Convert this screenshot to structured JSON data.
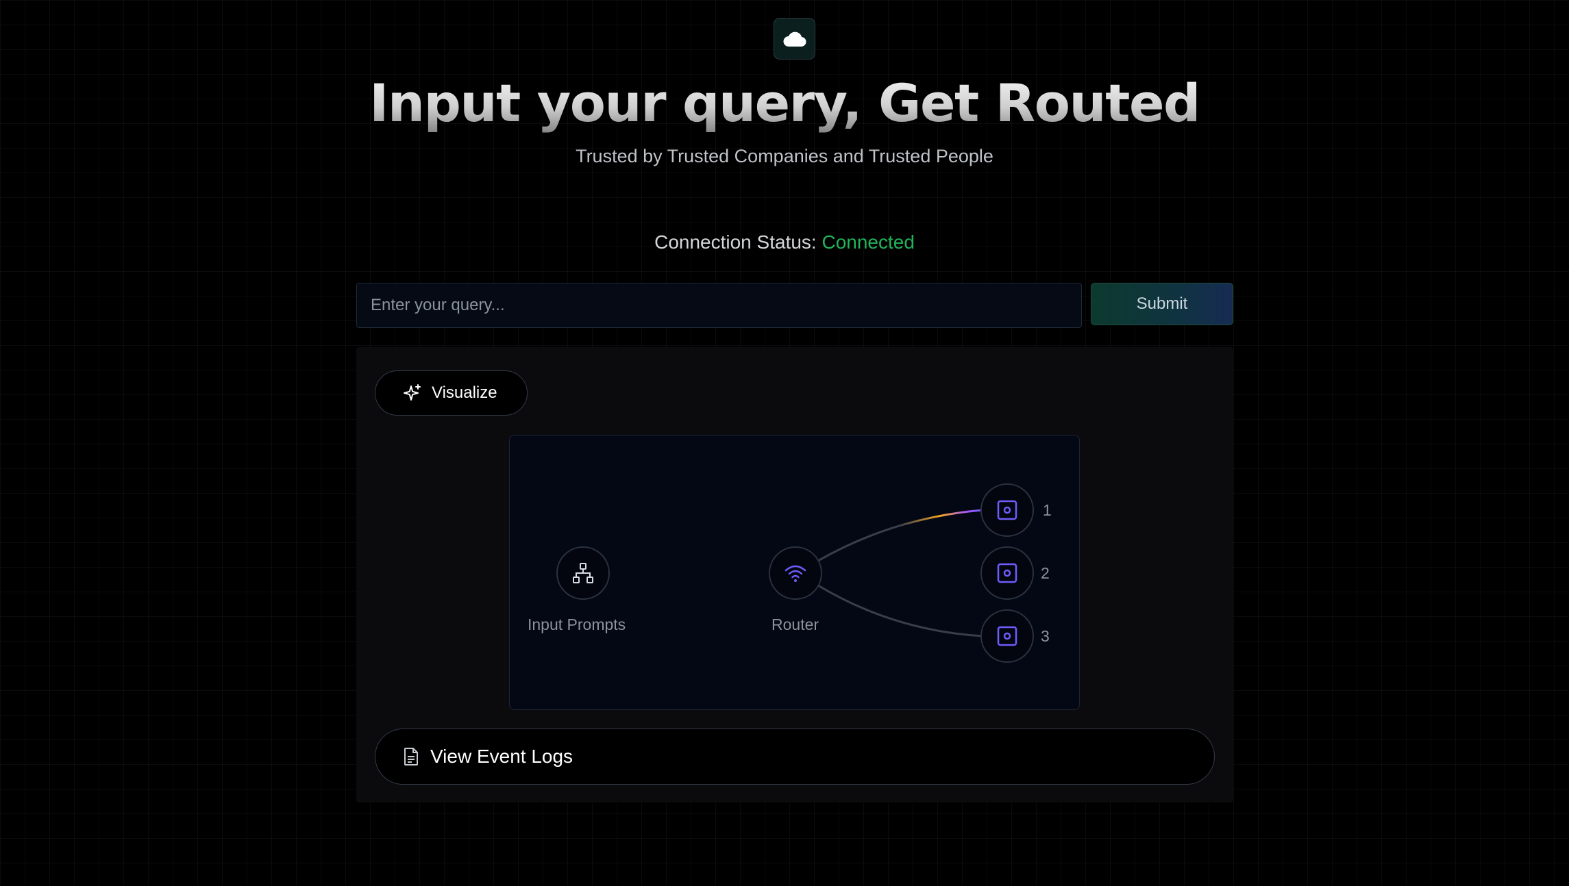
{
  "header": {
    "logo_icon": "cloud-icon",
    "title": "Input your query, Get Routed",
    "subtitle": "Trusted by Trusted Companies and Trusted People"
  },
  "status": {
    "label": "Connection Status:",
    "value": "Connected",
    "value_color": "#22b35a"
  },
  "query": {
    "placeholder": "Enter your query...",
    "value": "",
    "submit_label": "Submit"
  },
  "visualize": {
    "label": "Visualize",
    "icon": "sparkles-icon"
  },
  "diagram": {
    "input_label": "Input Prompts",
    "input_icon": "network-icon",
    "router_label": "Router",
    "router_icon": "wifi-icon",
    "models": [
      "1",
      "2",
      "3"
    ],
    "model_icon": "cpu-icon",
    "accent_colors": [
      "#f5a623",
      "#a855f7",
      "#6d5dfc"
    ]
  },
  "logs": {
    "label": "View Event Logs",
    "icon": "document-icon"
  }
}
